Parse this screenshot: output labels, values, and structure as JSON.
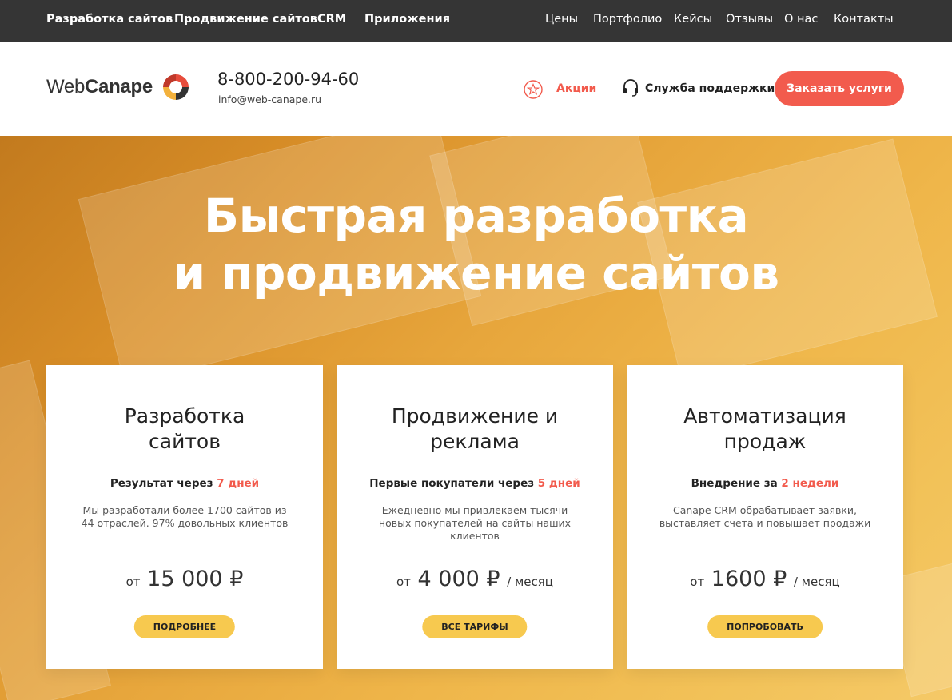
{
  "topnav": {
    "left": [
      "Разработка сайтов",
      "Продвижение сайтов",
      "CRM",
      "Приложения"
    ],
    "right": [
      "Цены",
      "Портфолио",
      "Кейсы",
      "Отзывы",
      "О нас",
      "Контакты"
    ]
  },
  "header": {
    "logo_part1": "Web",
    "logo_part2": "Canape",
    "phone": "8-800-200-94-60",
    "email": "info@web-canape.ru",
    "promo": "Акции",
    "support": "Служба поддержки",
    "order_button": "Заказать услуги"
  },
  "hero": {
    "title_line1": "Быстрая разработка",
    "title_line2": "и продвижение сайтов"
  },
  "cards": [
    {
      "title_line1": "Разработка",
      "title_line2": "сайтов",
      "sub_pre": "Результат через ",
      "sub_hl": "7 дней",
      "desc": "Мы разработали более 1700 сайтов из 44 отраслей. 97% довольных клиентов",
      "price_from": "от",
      "price": "15 000 ₽",
      "price_per": "",
      "button": "ПОДРОБНЕЕ"
    },
    {
      "title_line1": "Продвижение и",
      "title_line2": "реклама",
      "sub_pre": "Первые покупатели через ",
      "sub_hl": "5 дней",
      "desc": "Ежедневно мы привлекаем тысячи новых покупателей на сайты наших клиентов",
      "price_from": "от",
      "price": "4 000 ₽",
      "price_per": "/ месяц",
      "button": "ВСЕ ТАРИФЫ"
    },
    {
      "title_line1": "Автоматизация",
      "title_line2": "продаж",
      "sub_pre": "Внедрение за ",
      "sub_hl": "2 недели",
      "desc": "Canape CRM обрабатывает заявки, выставляет счета и повышает продажи",
      "price_from": "от",
      "price": "1600 ₽",
      "price_per": "/ месяц",
      "button": "ПОПРОБОВАТЬ"
    }
  ],
  "colors": {
    "accent": "#f25b4d",
    "button_yellow": "#f7c94f",
    "topnav_bg": "#353535"
  }
}
